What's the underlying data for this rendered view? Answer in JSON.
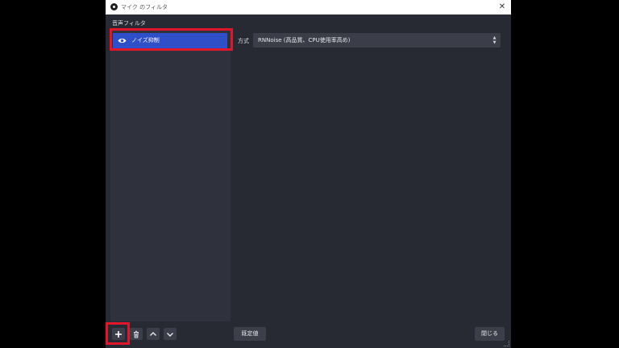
{
  "window": {
    "title": "マイク のフィルタ"
  },
  "section": {
    "audio_filters_label": "音声フィルタ"
  },
  "filters": {
    "items": [
      {
        "label": "ノイズ抑制",
        "visible": true,
        "selected": true
      }
    ]
  },
  "properties": {
    "method_label": "方式",
    "method_value": "RNNoise (高品質、CPU使用率高め)"
  },
  "buttons": {
    "defaults_label": "既定値",
    "close_label": "閉じる"
  },
  "icons": {
    "app": "obs-icon",
    "eye": "eye-icon",
    "add": "plus-icon",
    "remove": "trash-icon",
    "up": "chevron-up-icon",
    "down": "chevron-down-icon",
    "close": "close-icon"
  },
  "colors": {
    "selected_item": "#2e4fc7",
    "highlight_border": "#e0162b",
    "window_bg": "#272a33"
  }
}
